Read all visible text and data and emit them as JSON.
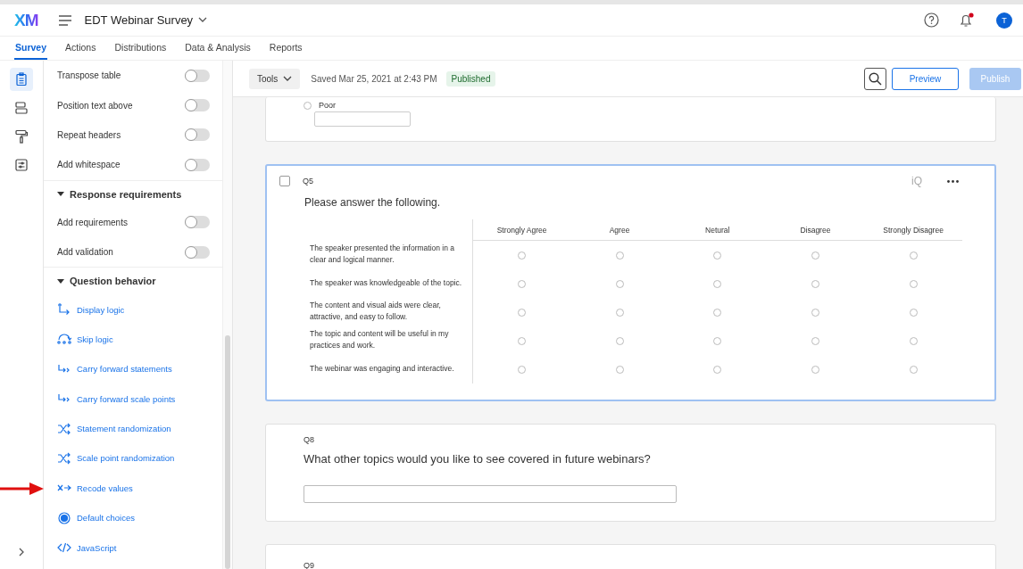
{
  "header": {
    "logo": "XM",
    "title": "EDT Webinar Survey",
    "notifications_unread": true,
    "avatar": "T"
  },
  "tabs": [
    {
      "label": "Survey",
      "selected": true
    },
    {
      "label": "Actions",
      "selected": false
    },
    {
      "label": "Distributions",
      "selected": false
    },
    {
      "label": "Data & Analysis",
      "selected": false
    },
    {
      "label": "Reports",
      "selected": false
    }
  ],
  "rail": [
    {
      "kind": "survey",
      "selected": true
    },
    {
      "kind": "layout",
      "selected": false
    },
    {
      "kind": "style",
      "selected": false
    },
    {
      "kind": "options",
      "selected": false
    }
  ],
  "panel": [
    {
      "kind": "toggle",
      "label": "Transpose table",
      "on": false
    },
    {
      "kind": "toggle",
      "label": "Position text above",
      "on": false
    },
    {
      "kind": "toggle",
      "label": "Repeat headers",
      "on": false
    },
    {
      "kind": "toggle",
      "label": "Add whitespace",
      "on": false
    },
    {
      "kind": "section",
      "label": "Response requirements",
      "expanded": true
    },
    {
      "kind": "toggle",
      "label": "Add requirements",
      "on": false
    },
    {
      "kind": "toggle",
      "label": "Add validation",
      "on": false
    },
    {
      "kind": "section",
      "label": "Question behavior",
      "expanded": true
    },
    {
      "kind": "display",
      "label": "Display logic",
      "annotated": false
    },
    {
      "kind": "skip",
      "label": "Skip logic",
      "annotated": false
    },
    {
      "kind": "carry",
      "label": "Carry forward statements",
      "annotated": false
    },
    {
      "kind": "carry",
      "label": "Carry forward scale points",
      "annotated": false
    },
    {
      "kind": "shuffle",
      "label": "Statement randomization",
      "annotated": false
    },
    {
      "kind": "shuffle",
      "label": "Scale point randomization",
      "annotated": false
    },
    {
      "kind": "recode",
      "label": "Recode values",
      "annotated": true
    },
    {
      "kind": "default",
      "label": "Default choices",
      "annotated": false
    },
    {
      "kind": "code",
      "label": "JavaScript",
      "annotated": false
    }
  ],
  "toolbar": {
    "tools": "Tools",
    "saved": "Saved Mar 25, 2021 at 2:43 PM",
    "status": "Published",
    "preview": "Preview",
    "publish": "Publish",
    "publish_disabled": true
  },
  "questions": [
    {
      "kind": "partial_choice",
      "option": "Poor",
      "selected": false
    },
    {
      "kind": "matrix",
      "id": "Q5",
      "assist": "iQ",
      "text": "Please answer the following.",
      "selected": true,
      "checked": false,
      "columns": [
        "Strongly Agree",
        "Agree",
        "Netural",
        "Disagree",
        "Strongly Disagree"
      ],
      "rows": [
        {
          "statement": "The speaker presented the information in a clear and logical manner.",
          "choices": [
            false,
            false,
            false,
            false,
            false
          ]
        },
        {
          "statement": "The speaker was knowledgeable of the topic.",
          "choices": [
            false,
            false,
            false,
            false,
            false
          ]
        },
        {
          "statement": "The content and visual aids were clear, attractive, and easy to follow.",
          "choices": [
            false,
            false,
            false,
            false,
            false
          ]
        },
        {
          "statement": "The topic and content will be useful in my practices and work.",
          "choices": [
            false,
            false,
            false,
            false,
            false
          ]
        },
        {
          "statement": "The webinar was engaging and interactive.",
          "choices": [
            false,
            false,
            false,
            false,
            false
          ]
        }
      ]
    },
    {
      "kind": "text_entry",
      "id": "Q8",
      "text": "What other topics would you like to see covered in future webinars?",
      "selected": false
    },
    {
      "kind": "header_only",
      "id": "Q9",
      "selected": false
    }
  ]
}
